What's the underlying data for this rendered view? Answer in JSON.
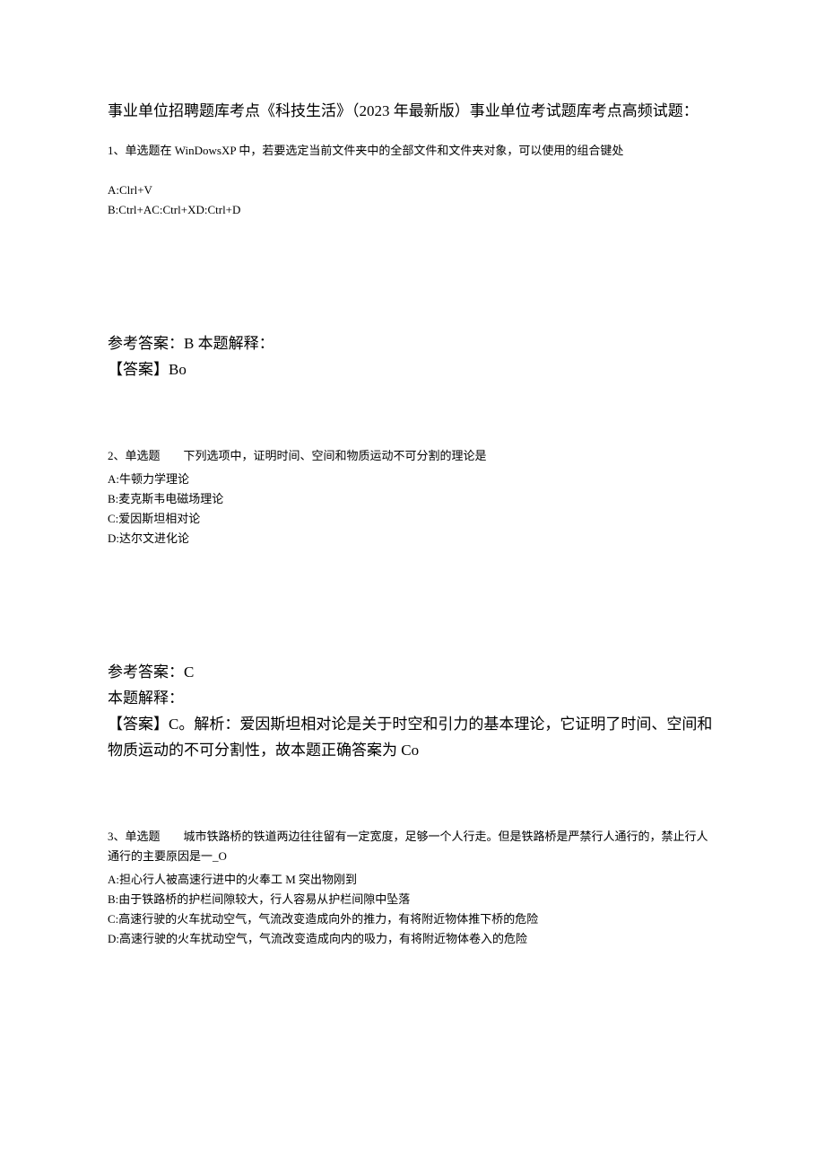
{
  "title": "事业单位招聘题库考点《科技生活》（2023 年最新版）事业单位考试题库考点高频试题：",
  "q1": {
    "stem": "1、单选题在 WinDowsXP 中，若要选定当前文件夹中的全部文件和文件夹对象，可以使用的组合键处",
    "optA": "A:Clrl+V",
    "optB": "B:Ctrl+AC:Ctrl+XD:Ctrl+D",
    "answer_line1": "参考答案：B 本题解释：",
    "answer_line2": "【答案】Bo"
  },
  "q2": {
    "stem": "2、单选题　　下列选项中，证明时间、空间和物质运动不可分割的理论是",
    "optA": "A:牛顿力学理论",
    "optB": "B:麦克斯韦电磁场理论",
    "optC": "C:爱因斯坦相对论",
    "optD": "D:达尔文进化论",
    "answer_line1": "参考答案：C",
    "answer_line2": "本题解释：",
    "answer_line3": "【答案】C。解析：爱因斯坦相对论是关于时空和引力的基本理论，它证明了时间、空间和物质运动的不可分割性，故本题正确答案为 Co"
  },
  "q3": {
    "stem": "3、单选题　　城市铁路桥的铁道两边往往留有一定宽度，足够一个人行走。但是铁路桥是严禁行人通行的，禁止行人通行的主要原因是一_O",
    "optA": "A:担心行人被高速行进中的火奉工 M 突出物刚到",
    "optB": "B:由于铁路桥的护栏间隙较大，行人容易从护栏间隙中坠落",
    "optC": "C:高速行驶的火车扰动空气，气流改变造成向外的推力，有将附近物体推下桥的危险",
    "optD": "D:高速行驶的火车扰动空气，气流改变造成向内的吸力，有将附近物体卷入的危险"
  }
}
